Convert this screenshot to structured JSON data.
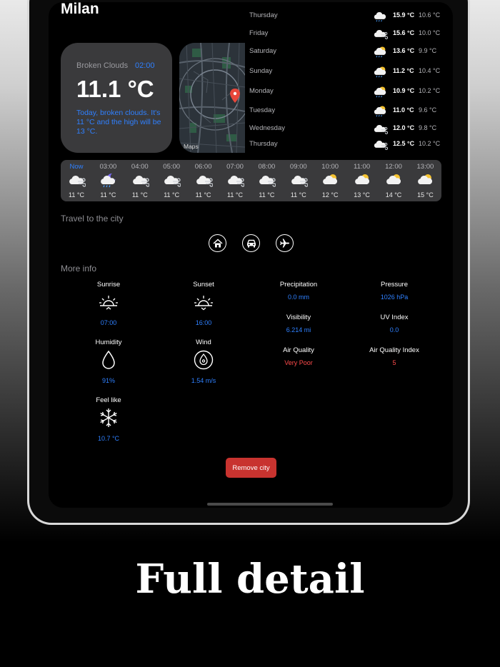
{
  "city": "Milan",
  "summary": {
    "condition": "Broken Clouds",
    "time": "02:00",
    "temperature": "11.1 °C",
    "description": "Today, broken clouds. It's 11 °C and the high will be 13 °C."
  },
  "map": {
    "label": "Maps"
  },
  "forecast": [
    {
      "day": "Thursday",
      "hi": "15.9 °C",
      "lo": "10.6 °C",
      "icon": "cloud-rain-icon"
    },
    {
      "day": "Friday",
      "hi": "15.6 °C",
      "lo": "10.0 °C",
      "icon": "cloud-wind-icon"
    },
    {
      "day": "Saturday",
      "hi": "13.6 °C",
      "lo": "9.9 °C",
      "icon": "cloud-rain-sun-icon"
    },
    {
      "day": "Sunday",
      "hi": "11.2 °C",
      "lo": "10.4 °C",
      "icon": "cloud-rain-sun-icon"
    },
    {
      "day": "Monday",
      "hi": "10.9 °C",
      "lo": "10.2 °C",
      "icon": "cloud-rain-sun-icon"
    },
    {
      "day": "Tuesday",
      "hi": "11.0 °C",
      "lo": "9.6 °C",
      "icon": "cloud-rain-sun-icon"
    },
    {
      "day": "Wednesday",
      "hi": "12.0 °C",
      "lo": "9.8 °C",
      "icon": "cloud-wind-icon"
    },
    {
      "day": "Thursday",
      "hi": "12.5 °C",
      "lo": "10.2 °C",
      "icon": "cloud-wind-icon"
    }
  ],
  "hourly": [
    {
      "time": "Now",
      "temp": "11 °C",
      "icon": "cloud-wind-icon"
    },
    {
      "time": "03:00",
      "temp": "11 °C",
      "icon": "cloud-moon-rain-icon"
    },
    {
      "time": "04:00",
      "temp": "11 °C",
      "icon": "cloud-wind-icon"
    },
    {
      "time": "05:00",
      "temp": "11 °C",
      "icon": "cloud-wind-icon"
    },
    {
      "time": "06:00",
      "temp": "11 °C",
      "icon": "cloud-wind-icon"
    },
    {
      "time": "07:00",
      "temp": "11 °C",
      "icon": "cloud-wind-icon"
    },
    {
      "time": "08:00",
      "temp": "11 °C",
      "icon": "cloud-wind-icon"
    },
    {
      "time": "09:00",
      "temp": "11 °C",
      "icon": "cloud-wind-icon"
    },
    {
      "time": "10:00",
      "temp": "12 °C",
      "icon": "cloud-sun-icon"
    },
    {
      "time": "11:00",
      "temp": "13 °C",
      "icon": "cloud-sun-icon"
    },
    {
      "time": "12:00",
      "temp": "14 °C",
      "icon": "cloud-sun-icon"
    },
    {
      "time": "13:00",
      "temp": "15 °C",
      "icon": "cloud-sun-icon"
    }
  ],
  "travel": {
    "title": "Travel to the city"
  },
  "more_info": {
    "title": "More info",
    "sunrise": {
      "label": "Sunrise",
      "value": "07:00"
    },
    "sunset": {
      "label": "Sunset",
      "value": "16:00"
    },
    "humidity": {
      "label": "Humidity",
      "value": "91%"
    },
    "wind": {
      "label": "Wind",
      "value": "1.54 m/s"
    },
    "feel_like": {
      "label": "Feel like",
      "value": "10.7 °C"
    },
    "precipitation": {
      "label": "Precipitation",
      "value": "0.0 mm"
    },
    "pressure": {
      "label": "Pressure",
      "value": "1026 hPa"
    },
    "visibility": {
      "label": "Visibility",
      "value": "6.214 mi"
    },
    "uv_index": {
      "label": "UV Index",
      "value": "0.0"
    },
    "air_quality": {
      "label": "Air Quality",
      "value": "Very Poor"
    },
    "air_quality_index": {
      "label": "Air Quality Index",
      "value": "5"
    }
  },
  "remove_button": "Remove city",
  "headline": "Full detail",
  "colors": {
    "accent": "#2f80ff",
    "danger": "#c8332f",
    "card": "#3a3a3c"
  }
}
